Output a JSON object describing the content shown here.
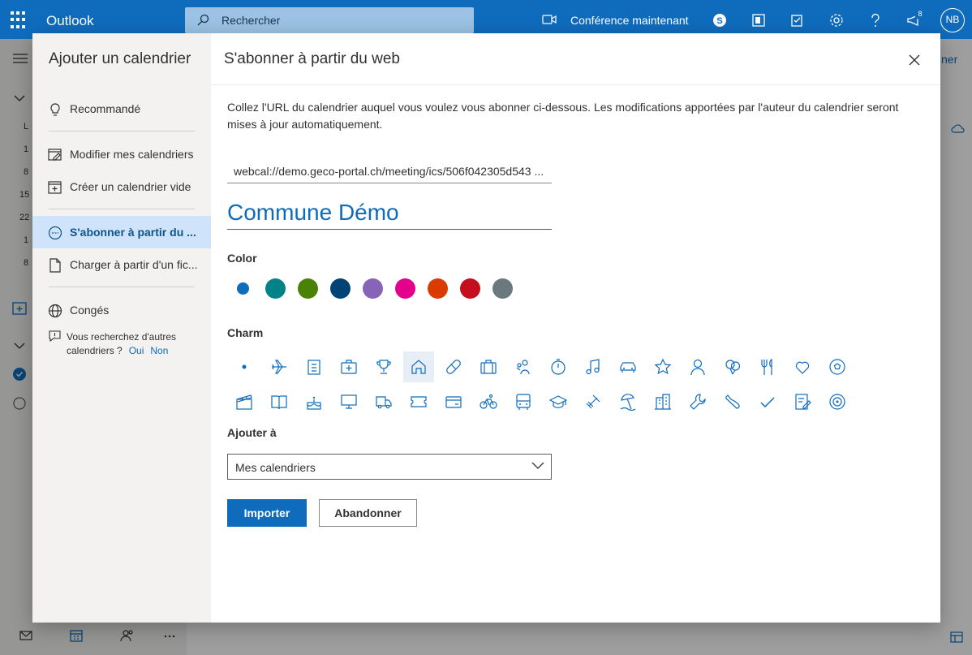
{
  "app": {
    "brand": "Outlook",
    "search_placeholder": "Rechercher",
    "meet_now": "Conférence maintenant",
    "notification_count": "8",
    "user_initials": "NB"
  },
  "background": {
    "mini_calendar": [
      "L",
      "1",
      "8",
      "15",
      "22",
      "1",
      "8"
    ],
    "partial_label": "ner"
  },
  "dialog": {
    "title": "Ajouter un calendrier",
    "nav": [
      {
        "label": "Recommandé"
      },
      {
        "label": "Modifier mes calendriers"
      },
      {
        "label": "Créer un calendrier vide"
      },
      {
        "label": "S'abonner à partir du ..."
      },
      {
        "label": "Charger à partir d'un fic..."
      },
      {
        "label": "Congés"
      }
    ],
    "more_text": "Vous recherchez d'autres calendriers ?",
    "more_yes": "Oui",
    "more_no": "Non",
    "heading": "S'abonner à partir du web",
    "description": "Collez l'URL du calendrier auquel vous voulez vous abonner ci-dessous. Les modifications apportées par l'auteur du calendrier seront mises à jour automatiquement.",
    "url_value": "webcal://demo.geco-portal.ch/meeting/ics/506f042305d543 ...",
    "calendar_name": "Commune Démo",
    "color_label": "Color",
    "colors": [
      "#0f6cbd",
      "#038387",
      "#498205",
      "#004377",
      "#8764b8",
      "#e3008c",
      "#da3b01",
      "#c50f1f",
      "#69797e"
    ],
    "selected_color": "#0f6cbd",
    "charm_label": "Charm",
    "charms_row1": [
      "dot-icon",
      "airplane-icon",
      "clipboard-icon",
      "medical-kit-icon",
      "trophy-icon",
      "home-icon",
      "pill-icon",
      "briefcase-icon",
      "people-icon",
      "stopwatch-icon",
      "music-note-icon",
      "car-icon",
      "star-icon",
      "person-icon",
      "balloon-icon",
      "fork-knife-icon",
      "heart-icon",
      "soccer-ball-icon"
    ],
    "charms_row2": [
      "clapper-icon",
      "book-icon",
      "cake-icon",
      "monitor-icon",
      "truck-icon",
      "ticket-icon",
      "wallet-icon",
      "bicycle-icon",
      "bus-icon",
      "graduation-cap-icon",
      "dumbbell-icon",
      "beach-icon",
      "building-icon",
      "wrench-icon",
      "shoe-icon",
      "checkmark-icon",
      "notes-icon",
      "target-icon"
    ],
    "selected_charm": "home-icon",
    "add_to_label": "Ajouter à",
    "add_to_value": "Mes calendriers",
    "import_label": "Importer",
    "cancel_label": "Abandonner"
  }
}
